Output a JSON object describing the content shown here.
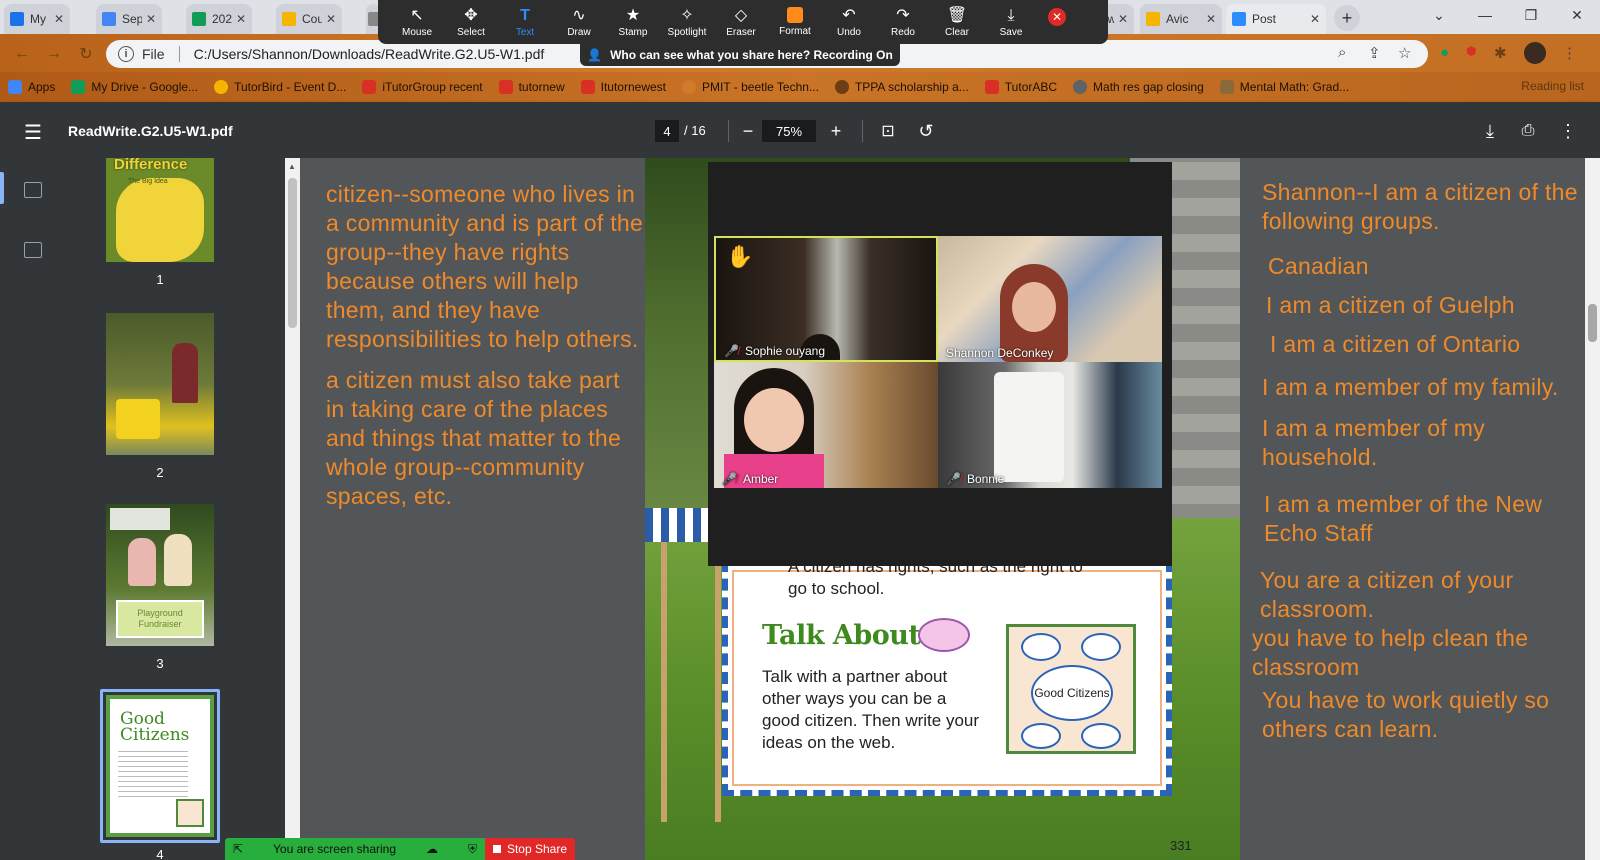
{
  "browser": {
    "tabs": [
      {
        "label": "My D",
        "color": "#1a73e8"
      },
      {
        "label": "Sept",
        "color": "#4285f4"
      },
      {
        "label": "202",
        "color": "#0f9d58"
      },
      {
        "label": "Cou",
        "color": "#f4b400"
      },
      {
        "label": "",
        "color": "#888888"
      },
      {
        "label": "New",
        "color": "#1a73e8"
      },
      {
        "label": "Avic",
        "color": "#f4b400"
      },
      {
        "label": "Post",
        "color": "#2d8cff"
      }
    ],
    "url_prefix": "File",
    "url": "C:/Users/Shannon/Downloads/ReadWrite.G2.U5-W1.pdf",
    "bookmarks": [
      {
        "label": "Apps",
        "color": "#4285f4"
      },
      {
        "label": "My Drive - Google...",
        "color": "#0f9d58"
      },
      {
        "label": "TutorBird - Event D...",
        "color": "#f4b400"
      },
      {
        "label": "iTutorGroup recent",
        "color": "#d93025"
      },
      {
        "label": "tutornew",
        "color": "#d93025"
      },
      {
        "label": "Itutornewest",
        "color": "#d93025"
      },
      {
        "label": "PMIT - beetle Techn...",
        "color": "#d07b2c"
      },
      {
        "label": "TPPA scholarship a...",
        "color": "#6b3f13"
      },
      {
        "label": "TutorABC",
        "color": "#d93025"
      },
      {
        "label": "Math res gap closing",
        "color": "#5f6368"
      },
      {
        "label": "Mental Math: Grad...",
        "color": "#8a6a3a"
      }
    ],
    "reading_list": "Reading list"
  },
  "zoom_toolbar": {
    "tools": [
      {
        "label": "Mouse",
        "glyph": "↖",
        "icon": "mouse-pointer-icon"
      },
      {
        "label": "Select",
        "glyph": "✥",
        "icon": "select-icon"
      },
      {
        "label": "Text",
        "glyph": "T",
        "icon": "text-icon"
      },
      {
        "label": "Draw",
        "glyph": "〜",
        "icon": "draw-icon"
      },
      {
        "label": "Stamp",
        "glyph": "★",
        "icon": "stamp-icon"
      },
      {
        "label": "Spotlight",
        "glyph": "✧",
        "icon": "spotlight-icon"
      },
      {
        "label": "Eraser",
        "glyph": "⌫",
        "icon": "eraser-icon"
      },
      {
        "label": "Format",
        "glyph": "",
        "icon": "format-icon"
      },
      {
        "label": "Undo",
        "glyph": "↶",
        "icon": "undo-icon"
      },
      {
        "label": "Redo",
        "glyph": "↷",
        "icon": "redo-icon"
      },
      {
        "label": "Clear",
        "glyph": "🗑",
        "icon": "trash-icon"
      },
      {
        "label": "Save",
        "glyph": "⤓",
        "icon": "save-icon"
      }
    ],
    "active_tool": "Text",
    "recording_notice": "Who can see what you share here? Recording On"
  },
  "pdf": {
    "document_name": "ReadWrite.G2.U5-W1.pdf",
    "current_page": "4",
    "total_pages": "/ 16",
    "zoom": "75%",
    "thumbnails": [
      {
        "number": "1",
        "title": "Difference",
        "subtitle": "The Big Idea"
      },
      {
        "number": "2"
      },
      {
        "number": "3",
        "banner": "Playground Fundraiser"
      },
      {
        "number": "4",
        "title": "Good Citizens"
      }
    ],
    "page_partial_line_1": "A citizen has rights, such as the right to",
    "page_partial_line_2": "go to school.",
    "talk_heading": "Talk About It",
    "talk_text": "Talk with a partner about other ways you can be a good citizen. Then write your ideas on the web.",
    "web_center": "Good Citizens",
    "page_number": "331"
  },
  "notes_left": [
    "citizen--someone who lives in a community and is part of the group--they have rights because others will help them, and they have responsibilities to help others.",
    "a citizen must also take part in taking care of the places and things that matter to the whole group--community spaces, etc."
  ],
  "notes_right": [
    "Shannon--I am a citizen of the following groups.",
    "Canadian",
    "I am a citizen of Guelph",
    "I am a citizen of Ontario",
    "I am a member of my family.",
    "I am a member of my household.",
    "I am a member of the New Echo Staff",
    "You are a citizen of your classroom.",
    "you have to help clean the classroom",
    "You have to work quietly so others can learn."
  ],
  "participants": [
    {
      "name": "Sophie ouyang",
      "hand_raised": true,
      "speaking": true
    },
    {
      "name": "Shannon DeConkey"
    },
    {
      "name": "Amber"
    },
    {
      "name": "Bonnie"
    }
  ],
  "sharing": {
    "status": "You are screen sharing",
    "stop_label": "Stop Share"
  }
}
